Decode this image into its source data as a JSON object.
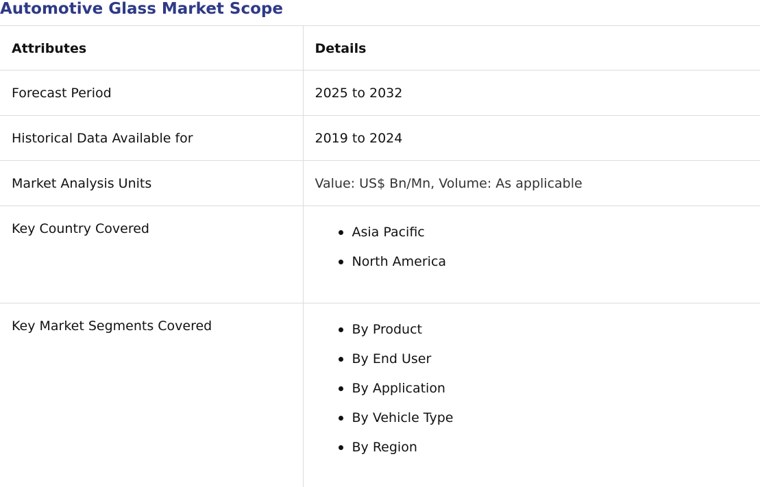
{
  "title": "Automotive Glass Market Scope",
  "table": {
    "headers": {
      "attributes": "Attributes",
      "details": "Details"
    },
    "rows": [
      {
        "attribute": "Forecast Period",
        "detail": "2025 to 2032"
      },
      {
        "attribute": "Historical Data Available for",
        "detail": "2019 to 2024"
      },
      {
        "attribute": "Market Analysis Units",
        "detail": "Value: US$ Bn/Mn, Volume: As applicable"
      }
    ],
    "country": {
      "attribute": "Key Country Covered",
      "items": [
        "Asia Pacific",
        "North America"
      ]
    },
    "segments": {
      "attribute": "Key Market Segments Covered",
      "items": [
        "By Product",
        "By End User",
        "By Application",
        "By Vehicle Type",
        "By Region"
      ]
    }
  },
  "colors": {
    "title": "#2e3a87",
    "border": "#dcdcdc",
    "text": "#111111"
  }
}
